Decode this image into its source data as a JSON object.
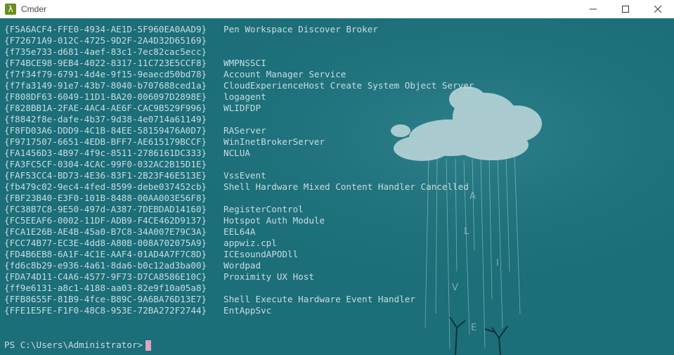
{
  "window": {
    "title": "Cmder",
    "icon": "lambda-icon",
    "controls": [
      "minimize-icon",
      "maximize-icon",
      "close-icon"
    ]
  },
  "terminal": {
    "rows": [
      {
        "guid": "{F5A6ACF4-FFE0-4934-AE1D-5F960EA0AAD9}",
        "name": "Pen Workspace Discover Broker"
      },
      {
        "guid": "{F72671A9-012C-4725-9D2F-2A4D32D65169}",
        "name": ""
      },
      {
        "guid": "{f735e733-d681-4aef-83c1-7ec82cac5ecc}",
        "name": ""
      },
      {
        "guid": "{F74BCE98-9EB4-4022-8317-11C723E5CCF8}",
        "name": "WMPNSSCI"
      },
      {
        "guid": "{f7f34f79-6791-4d4e-9f15-9eaecd50bd78}",
        "name": "Account Manager Service"
      },
      {
        "guid": "{f7fa3149-91e7-43b7-8040-b707688ced1a}",
        "name": "CloudExperienceHost Create System Object Server"
      },
      {
        "guid": "{F808DF63-6049-11D1-BA20-006097D2898E}",
        "name": "logagent"
      },
      {
        "guid": "{F828BB1A-2FAE-4AC4-AE6F-CAC9B529F996}",
        "name": "WLIDFDP"
      },
      {
        "guid": "{f8842f8e-dafe-4b37-9d38-4e0714a61149}",
        "name": ""
      },
      {
        "guid": "{F8FD03A6-DDD9-4C1B-84EE-58159476A0D7}",
        "name": "RAServer"
      },
      {
        "guid": "{F9717507-6651-4EDB-BFF7-AE615179BCCF}",
        "name": "WinInetBrokerServer"
      },
      {
        "guid": "{FA1456D3-4B97-4f9c-8511-2786161DC333}",
        "name": "NCLUA"
      },
      {
        "guid": "{FA3FC5CF-0304-4CAC-99F0-032AC2B15D1E}",
        "name": ""
      },
      {
        "guid": "{FAF53CC4-BD73-4E36-83F1-2B23F46E513E}",
        "name": "VssEvent"
      },
      {
        "guid": "{fb479c02-9ec4-4fed-8599-debe037452cb}",
        "name": "Shell Hardware Mixed Content Handler Cancelled"
      },
      {
        "guid": "{FBF23B40-E3F0-101B-8488-00AA003E56F8}",
        "name": ""
      },
      {
        "guid": "{FC38B7C8-9E50-497d-A387-7DEBDAD14160}",
        "name": "RegisterControl"
      },
      {
        "guid": "{FC5EEAF6-0002-11DF-ADB9-F4CE462D9137}",
        "name": "Hotspot Auth Module"
      },
      {
        "guid": "{FCA1E26B-AE4B-45a0-B7C8-34A007E79C3A}",
        "name": "EEL64A"
      },
      {
        "guid": "{FCC74B77-EC3E-4dd8-A80B-008A702075A9}",
        "name": "appwiz.cpl"
      },
      {
        "guid": "{FD4B6EB8-6A1F-4C1E-AAF4-01AD4A7F7C8D}",
        "name": "ICEsoundAPODll"
      },
      {
        "guid": "{fd6c8b29-e936-4a61-8da6-b0c12ad3ba00}",
        "name": "Wordpad"
      },
      {
        "guid": "{FDA74D11-C4A6-4577-9F73-D7CA8586E10C}",
        "name": "Proximity UX Host"
      },
      {
        "guid": "{ff9e6131-a8c1-4188-aa03-82e9f10a05a8}",
        "name": ""
      },
      {
        "guid": "{FFB8655F-81B9-4fce-B89C-9A6BA76D13E7}",
        "name": "Shell Execute Hardware Event Handler"
      },
      {
        "guid": "{FFE1E5FE-F1F0-48C8-953E-72BA272F2744}",
        "name": "EntAppSvc"
      }
    ],
    "prompt": "PS C:\\Users\\Administrator>",
    "colors": {
      "background": "#1c6e78",
      "text": "#c8dde0",
      "cursor": "#e0a4c4"
    }
  }
}
